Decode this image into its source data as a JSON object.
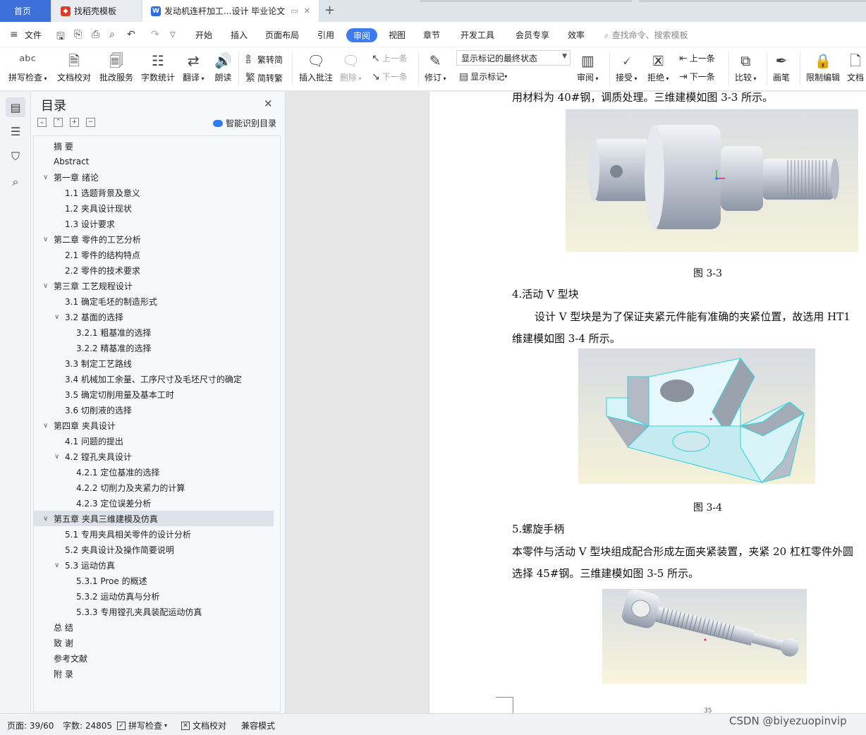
{
  "tabs": {
    "home": "首页",
    "daoke": "找稻壳模板",
    "doc": "发动机连杆加工...设计 毕业论文",
    "add": "+"
  },
  "menu": {
    "file": "文件",
    "items": [
      "开始",
      "插入",
      "页面布局",
      "引用",
      "视图",
      "章节",
      "开发工具",
      "会员专享",
      "效率"
    ],
    "active": "审阅",
    "search": "查找命令、搜索模板"
  },
  "ribbon": {
    "spell": "拼写检查",
    "doc_check": "文档校对",
    "correction": "批改服务",
    "word_count": "字数统计",
    "translate": "翻译",
    "read": "朗读",
    "trad": "繁转简",
    "simp": "简转繁",
    "insert_comment": "插入批注",
    "delete": "删除",
    "prev": "上一条",
    "next": "下一条",
    "revise": "修订",
    "markup_state": "显示标记的最终状态",
    "show_markup": "显示标记",
    "review": "审阅",
    "accept": "接受",
    "reject": "拒绝",
    "prev2": "上一条",
    "next2": "下一条",
    "compare": "比较",
    "pen": "画笔",
    "restrict": "限制编辑",
    "doc_more": "文档"
  },
  "toc": {
    "title": "目录",
    "smart": "智能识别目录",
    "items": [
      {
        "text": "摘  要",
        "level": 1,
        "chev": ""
      },
      {
        "text": "Abstract",
        "level": 1,
        "chev": ""
      },
      {
        "text": "第一章  绪论",
        "level": 1,
        "chev": "v"
      },
      {
        "text": "1.1 选题背景及意义",
        "level": 2,
        "chev": ""
      },
      {
        "text": "1.2 夹具设计现状",
        "level": 2,
        "chev": ""
      },
      {
        "text": "1.3 设计要求",
        "level": 2,
        "chev": ""
      },
      {
        "text": "第二章  零件的工艺分析",
        "level": 1,
        "chev": "v"
      },
      {
        "text": "2.1  零件的结构特点",
        "level": 2,
        "chev": ""
      },
      {
        "text": "2.2  零件的技术要求",
        "level": 2,
        "chev": ""
      },
      {
        "text": "第三章  工艺规程设计",
        "level": 1,
        "chev": "v"
      },
      {
        "text": "3.1  确定毛坯的制造形式",
        "level": 2,
        "chev": ""
      },
      {
        "text": "3.2 基面的选择",
        "level": 2,
        "chev": "v"
      },
      {
        "text": "3.2.1 粗基准的选择",
        "level": 3,
        "chev": ""
      },
      {
        "text": "3.2.2  精基准的选择",
        "level": 3,
        "chev": ""
      },
      {
        "text": "3.3  制定工艺路线",
        "level": 2,
        "chev": ""
      },
      {
        "text": "3.4  机械加工余量、工序尺寸及毛坯尺寸的确定",
        "level": 2,
        "chev": ""
      },
      {
        "text": "3.5 确定切削用量及基本工时",
        "level": 2,
        "chev": ""
      },
      {
        "text": "3.6  切削液的选择",
        "level": 2,
        "chev": ""
      },
      {
        "text": "第四章  夹具设计",
        "level": 1,
        "chev": "v"
      },
      {
        "text": "4.1  问题的提出",
        "level": 2,
        "chev": ""
      },
      {
        "text": "4.2  镗孔夹具设计",
        "level": 2,
        "chev": "v"
      },
      {
        "text": "4.2.1  定位基准的选择",
        "level": 3,
        "chev": ""
      },
      {
        "text": "4.2.2  切削力及夹紧力的计算",
        "level": 3,
        "chev": ""
      },
      {
        "text": "4.2.3  定位误差分析",
        "level": 3,
        "chev": ""
      },
      {
        "text": "第五章  夹具三维建模及仿真",
        "level": 1,
        "chev": "v",
        "selected": true
      },
      {
        "text": "5.1 专用夹具相关零件的设计分析",
        "level": 2,
        "chev": ""
      },
      {
        "text": "5.2 夹具设计及操作简要说明",
        "level": 2,
        "chev": ""
      },
      {
        "text": "5.3 运动仿真",
        "level": 2,
        "chev": "v"
      },
      {
        "text": "5.3.1 Proe 的概述",
        "level": 3,
        "chev": ""
      },
      {
        "text": "5.3.2 运动仿真与分析",
        "level": 3,
        "chev": ""
      },
      {
        "text": "5.3.3 专用镗孔夹具装配运动仿真",
        "level": 3,
        "chev": ""
      },
      {
        "text": "总  结",
        "level": 1,
        "chev": ""
      },
      {
        "text": "致  谢",
        "level": 1,
        "chev": ""
      },
      {
        "text": "参考文献",
        "level": 1,
        "chev": ""
      },
      {
        "text": "附  录",
        "level": 1,
        "chev": ""
      }
    ]
  },
  "doc": {
    "line_top": "用材料为 40#钢，调质处理。三维建模如图 3-3 所示。",
    "cap1": "图 3-3",
    "head4": "4.活动 V 型块",
    "para4a": "设计 V 型块是为了保证夹紧元件能有准确的夹紧位置，故选用 HT1",
    "para4b": "维建模如图 3-4 所示。",
    "cap2": "图 3-4",
    "head5": "5.螺旋手柄",
    "para5a": "本零件与活动 V 型块组成配合形成左面夹紧装置，夹紧 20 杠杠零件外圆",
    "para5b": "选择 45#钢。三维建模如图 3-5 所示。",
    "page_number": "35"
  },
  "status": {
    "page": "页面: 39/60",
    "words": "字数: 24805",
    "spell": "拼写检查",
    "doc_check": "文档校对",
    "compat": "兼容模式"
  },
  "watermark": "CSDN @biyezuopinvip"
}
